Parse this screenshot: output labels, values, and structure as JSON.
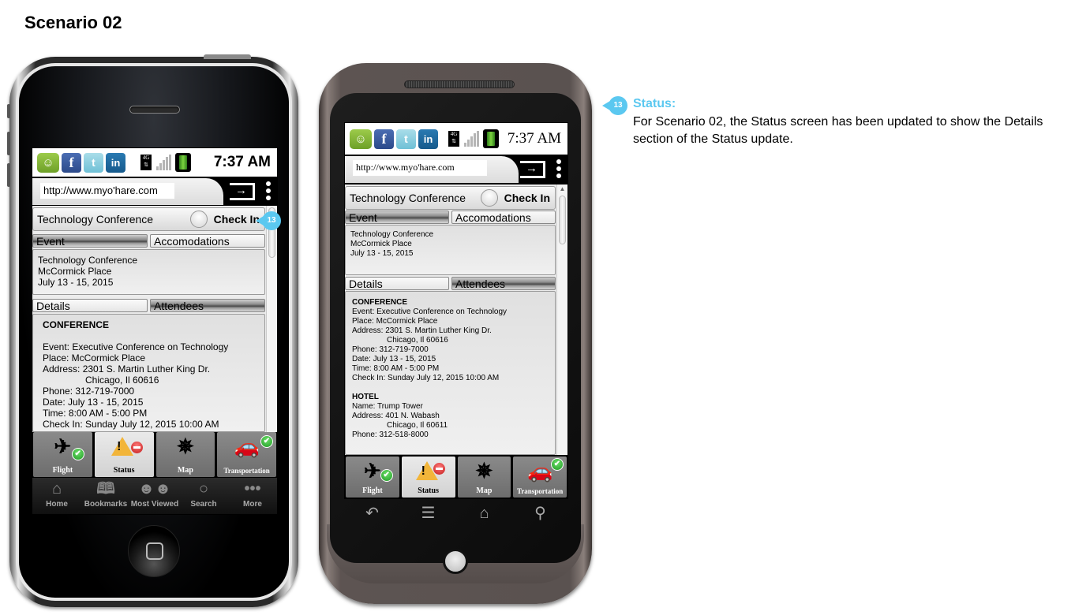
{
  "page": {
    "title": "Scenario 02"
  },
  "annotation": {
    "marker": "13",
    "title": "Status:",
    "body": "For Scenario 02, the Status screen has been updated to show the Details section of the Status update.",
    "accent_color": "#5bc8f0"
  },
  "phones": {
    "iphone": {
      "statusbar": {
        "icons": [
          "message-icon",
          "facebook-icon",
          "twitter-icon",
          "linkedin-icon"
        ],
        "facebook_glyph": "f",
        "twitter_glyph": "t",
        "linkedin_glyph": "in",
        "network": "4G",
        "time": "7:37 AM"
      },
      "url": "http://www.myo'hare.com",
      "header": {
        "title": "Technology Conference",
        "checkin_label": "Check In",
        "checked": false
      },
      "top_tabs": [
        {
          "label": "Event",
          "active": true
        },
        {
          "label": "Accomodations",
          "active": false
        }
      ],
      "event_panel": [
        "Technology Conference",
        "McCormick Place",
        "July 13 - 15, 2015"
      ],
      "bottom_tabs": [
        {
          "label": "Details",
          "active": true
        },
        {
          "label": "Attendees",
          "active": false
        }
      ],
      "details": {
        "heading": "CONFERENCE",
        "event": "Event: Executive Conference on Technology",
        "place": "Place: McCormick Place",
        "address1": "Address: 2301 S. Martin Luther King Dr.",
        "address2": "Chicago, Il 60616",
        "phone": "Phone: 312-719-7000",
        "date": "Date: July 13 - 15, 2015",
        "time": "Time: 8:00 AM - 5:00 PM",
        "checkin": "Check In: Sunday July 12, 2015 10:00 AM"
      },
      "app_tabs": [
        {
          "label": "Flight",
          "icon": "airplane-icon",
          "badge": "check",
          "active": false
        },
        {
          "label": "Status",
          "icon": "warning-icon",
          "badge": "no-entry",
          "active": true
        },
        {
          "label": "Map",
          "icon": "compass-icon",
          "badge": "",
          "active": false
        },
        {
          "label": "Transportation",
          "icon": "car-icon",
          "badge": "check",
          "active": false
        }
      ],
      "ios_bar": [
        {
          "label": "Home",
          "icon": "home-icon"
        },
        {
          "label": "Bookmarks",
          "icon": "book-icon"
        },
        {
          "label": "Most Viewed",
          "icon": "people-icon"
        },
        {
          "label": "Search",
          "icon": "search-icon"
        },
        {
          "label": "More",
          "icon": "more-icon"
        }
      ]
    },
    "android": {
      "statusbar": {
        "facebook_glyph": "f",
        "twitter_glyph": "t",
        "linkedin_glyph": "in",
        "network": "4G",
        "time": "7:37 AM"
      },
      "url": "http://www.myo'hare.com",
      "header": {
        "title": "Technology Conference",
        "checkin_label": "Check In",
        "checked": false
      },
      "top_tabs": [
        {
          "label": "Event",
          "active": true
        },
        {
          "label": "Accomodations",
          "active": false
        }
      ],
      "event_panel": [
        "Technology Conference",
        "McCormick Place",
        "July 13 - 15, 2015"
      ],
      "bottom_tabs": [
        {
          "label": "Details",
          "active": true
        },
        {
          "label": "Attendees",
          "active": false
        }
      ],
      "details": {
        "heading": "CONFERENCE",
        "event": "Event: Executive Conference on Technology",
        "place": "Place: McCormick Place",
        "address1": "Address: 2301 S. Martin Luther King Dr.",
        "address2": "Chicago, Il 60616",
        "phone": "Phone: 312-719-7000",
        "date": "Date: July 13 - 15, 2015",
        "time": "Time: 8:00 AM - 5:00 PM",
        "checkin": "Check In: Sunday July 12, 2015 10:00 AM",
        "hotel_heading": "HOTEL",
        "hotel_name": "Name: Trump Tower",
        "hotel_address1": "Address: 401 N. Wabash",
        "hotel_address2": "Chicago, Il 60611",
        "hotel_phone": "Phone: 312-518-8000"
      },
      "app_tabs": [
        {
          "label": "Flight",
          "icon": "airplane-icon",
          "badge": "check",
          "active": false
        },
        {
          "label": "Status",
          "icon": "warning-icon",
          "badge": "no-entry",
          "active": true
        },
        {
          "label": "Map",
          "icon": "compass-icon",
          "badge": "",
          "active": false
        },
        {
          "label": "Transportation",
          "icon": "car-icon",
          "badge": "check",
          "active": false
        }
      ],
      "nav_bar": [
        {
          "icon": "back-icon"
        },
        {
          "icon": "menu-icon"
        },
        {
          "icon": "home-icon"
        },
        {
          "icon": "search-icon"
        }
      ]
    }
  },
  "glyphs": {
    "airplane": "✈",
    "compass": "✵",
    "car": "🚗",
    "check": "✔",
    "warn": "!",
    "go_arrow": "→",
    "home": "⌂",
    "book": "📖",
    "people": "👥",
    "search": "⚲",
    "more": "•••",
    "back": "↶",
    "menu": "☰",
    "scroll_up": "▲"
  }
}
